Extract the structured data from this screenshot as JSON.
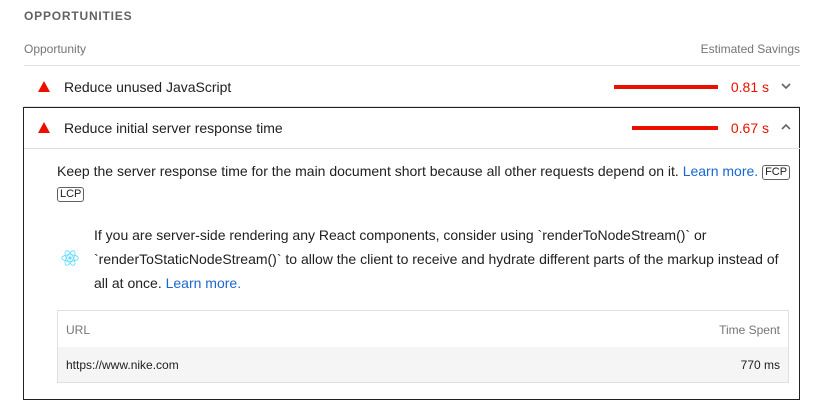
{
  "section": {
    "title": "OPPORTUNITIES"
  },
  "header": {
    "opportunity_label": "Opportunity",
    "savings_label": "Estimated Savings"
  },
  "colors": {
    "fail": "#eb0f00",
    "link": "#1967d2"
  },
  "audits": [
    {
      "title": "Reduce unused JavaScript",
      "savings": "0.81 s",
      "savings_fraction": 1.0,
      "expanded": false,
      "icon": "chevron-down-icon"
    },
    {
      "title": "Reduce initial server response time",
      "savings": "0.67 s",
      "savings_fraction": 0.83,
      "expanded": true,
      "icon": "chevron-up-icon",
      "description": "Keep the server response time for the main document short because all other requests depend on it.",
      "learn_more": "Learn more.",
      "tags": [
        "FCP",
        "LCP"
      ],
      "stack_pack": {
        "icon": "react-icon",
        "text": "If you are server-side rendering any React components, consider using `renderToNodeStream()` or `renderToStaticNodeStream()` to allow the client to receive and hydrate different parts of the markup instead of all at once.",
        "learn_more": "Learn more."
      },
      "table": {
        "columns": [
          "URL",
          "Time Spent"
        ],
        "rows": [
          {
            "url": "https://www.nike.com",
            "time": "770 ms"
          }
        ]
      }
    }
  ]
}
